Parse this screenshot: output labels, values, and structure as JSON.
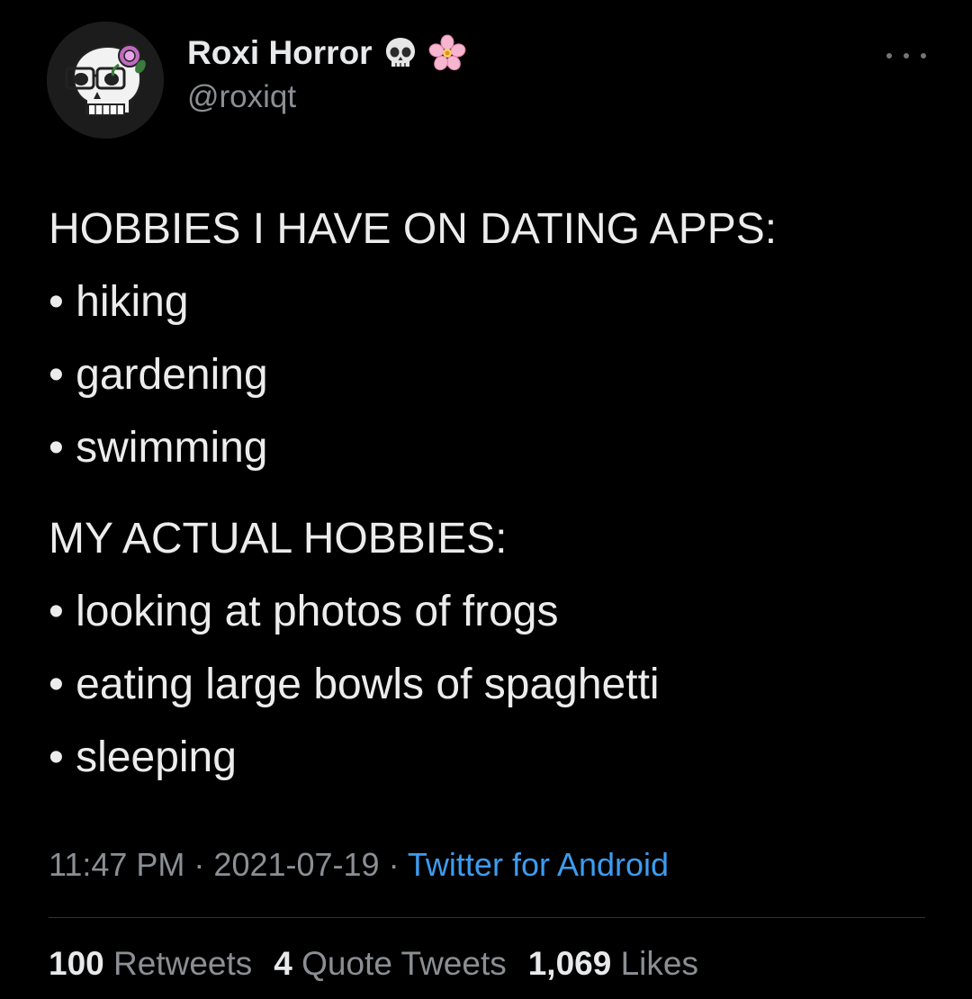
{
  "author": {
    "display_name": "Roxi Horror",
    "handle": "@roxiqt",
    "badge_emojis": [
      "skull-emoji",
      "cherry-blossom-emoji"
    ]
  },
  "tweet": {
    "lines": [
      "HOBBIES I HAVE ON DATING APPS:",
      "• hiking",
      "• gardening",
      "• swimming",
      "MY ACTUAL HOBBIES:",
      "• looking at photos of frogs",
      "• eating large bowls of spaghetti",
      "• sleeping"
    ]
  },
  "meta": {
    "time": "11:47 PM",
    "separator": " · ",
    "date": "2021-07-19",
    "source": "Twitter for Android"
  },
  "stats": {
    "retweets_count": "100",
    "retweets_label": "Retweets",
    "quotes_count": "4",
    "quotes_label": "Quote Tweets",
    "likes_count": "1,069",
    "likes_label": "Likes"
  },
  "colors": {
    "background": "#000000",
    "text": "#e7e9ea",
    "secondary": "#8b8f94",
    "link": "#3d9cef"
  }
}
